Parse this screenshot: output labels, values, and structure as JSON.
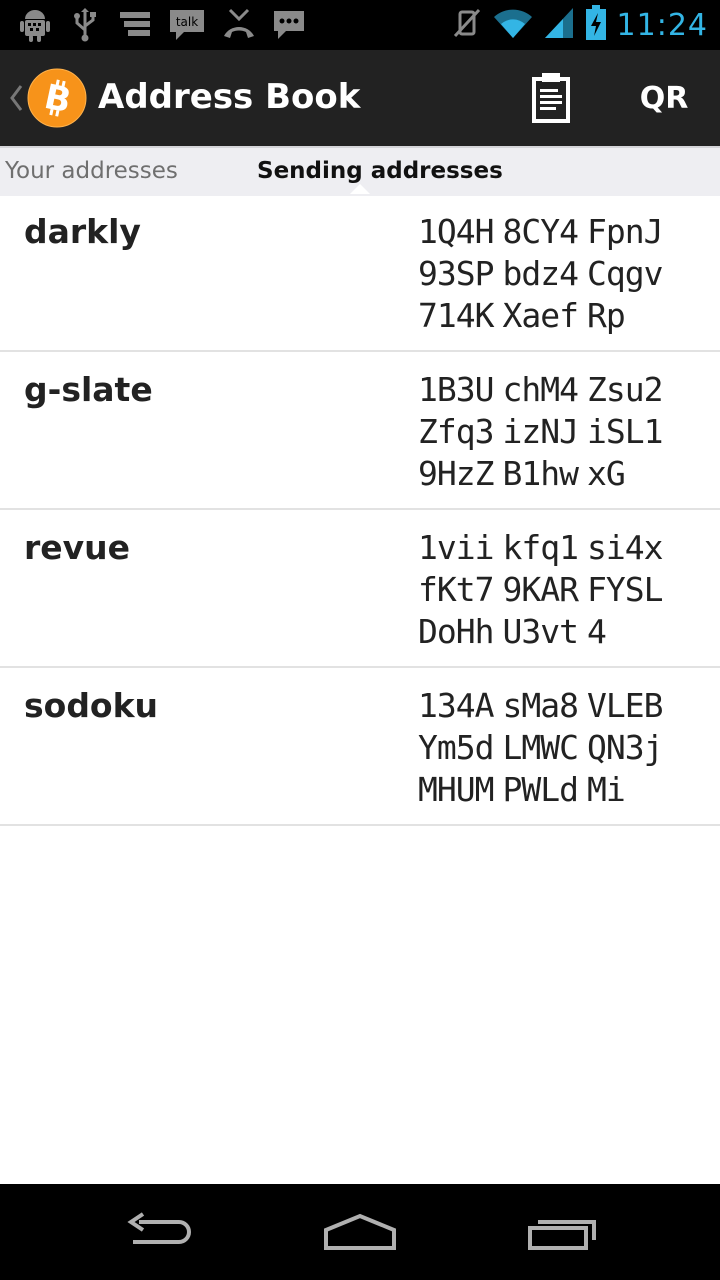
{
  "status_bar": {
    "notification_icons": [
      "android-debug-icon",
      "usb-icon",
      "storage-icon",
      "talk-icon",
      "missed-call-icon",
      "sms-icon"
    ],
    "talk_label": "talk",
    "time": "11:24",
    "accent_color": "#33b5e5"
  },
  "action_bar": {
    "title": "Address Book",
    "qr_label": "QR"
  },
  "tabs": [
    {
      "label": "Your addresses",
      "selected": false
    },
    {
      "label": "Sending addresses",
      "selected": true
    }
  ],
  "addresses": [
    {
      "label": "darkly",
      "lines": [
        [
          "1Q4H",
          "8CY4",
          "FpnJ"
        ],
        [
          "93SP",
          "bdz4",
          "Cqgv"
        ],
        [
          "714K",
          "Xaef",
          "Rp"
        ]
      ]
    },
    {
      "label": "g-slate",
      "lines": [
        [
          "1B3U",
          "chM4",
          "Zsu2"
        ],
        [
          "Zfq3",
          "izNJ",
          "iSL1"
        ],
        [
          "9HzZ",
          "B1hw",
          "xG"
        ]
      ]
    },
    {
      "label": "revue",
      "lines": [
        [
          "1vii",
          "kfq1",
          "si4x"
        ],
        [
          "fKt7",
          "9KAR",
          "FYSL"
        ],
        [
          "DoHh",
          "U3vt",
          "4"
        ]
      ]
    },
    {
      "label": "sodoku",
      "lines": [
        [
          "134A",
          "sMa8",
          "VLEB"
        ],
        [
          "Ym5d",
          "LMWC",
          "QN3j"
        ],
        [
          "MHUM",
          "PWLd",
          "Mi"
        ]
      ]
    }
  ]
}
